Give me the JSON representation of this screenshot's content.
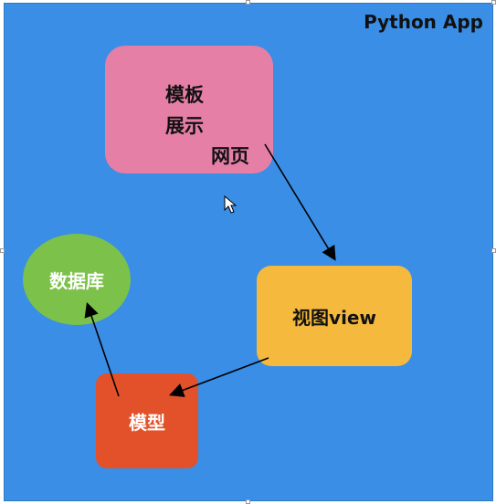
{
  "app_title": "Python App",
  "nodes": {
    "template": {
      "line1": "模板",
      "line2": "展示",
      "line3": "网页",
      "color": "#e57fa6"
    },
    "view": {
      "label": "视图view",
      "color": "#f5b93e"
    },
    "database": {
      "label": "数据库",
      "color": "#7cc14a"
    },
    "model": {
      "label": "模型",
      "color": "#e3512a"
    }
  },
  "background_color": "#3a8ee6",
  "edges": [
    {
      "from": "template",
      "to": "view"
    },
    {
      "from": "view",
      "to": "model"
    },
    {
      "from": "model",
      "to": "database"
    }
  ]
}
